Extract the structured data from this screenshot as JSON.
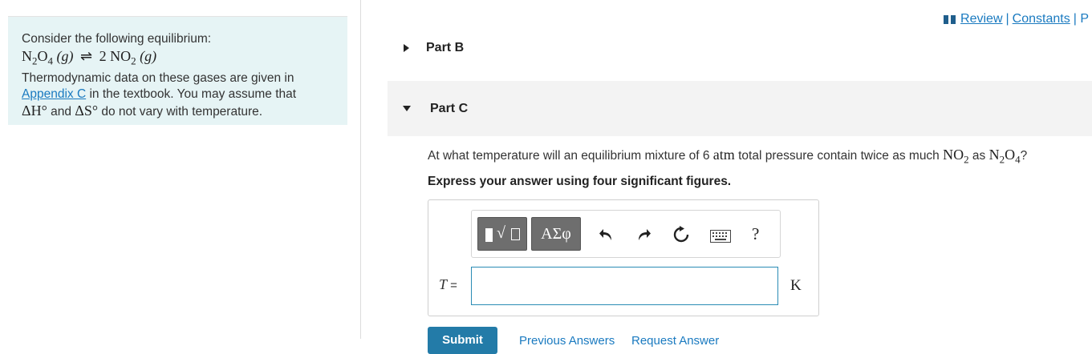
{
  "intro": {
    "line1": "Consider the following equilibrium:",
    "equation_left": "N",
    "equation_sub1": "2",
    "equation_O": "O",
    "equation_sub2": "4",
    "equation_phase1": "(g)",
    "equation_arrow": "⇌",
    "equation_coeff": "2 NO",
    "equation_sub3": "2",
    "equation_phase2": "(g)",
    "line2": "Thermodynamic data on these gases are given in",
    "appendix_link": "Appendix C",
    "line3_rest": " in the textbook. You may assume that",
    "dh": "ΔH°",
    "and": " and ",
    "ds": "ΔS°",
    "line4_rest": " do not vary with temperature."
  },
  "toplinks": {
    "review": "Review",
    "sep": "|",
    "constants": "Constants",
    "cut": "|  P"
  },
  "parts": {
    "part_b": "Part B",
    "part_c": "Part C"
  },
  "question": {
    "p1": "At what temperature will an equilibrium mixture of 6 ",
    "atm": "atm",
    "p2": " total pressure contain twice as much ",
    "no2_a": "NO",
    "no2_sub": "2",
    "p3": " as ",
    "n2o4_a": "N",
    "n2o4_sub1": "2",
    "n2o4_b": "O",
    "n2o4_sub2": "4",
    "p4": "?",
    "instruction": "Express your answer using four significant figures."
  },
  "toolbar": {
    "greek": "ΑΣφ",
    "help": "?"
  },
  "answer": {
    "variable": "T",
    "equals": " =",
    "value": "",
    "unit": "K"
  },
  "buttons": {
    "submit": "Submit",
    "previous_answers": "Previous Answers",
    "request_answer": "Request Answer"
  }
}
